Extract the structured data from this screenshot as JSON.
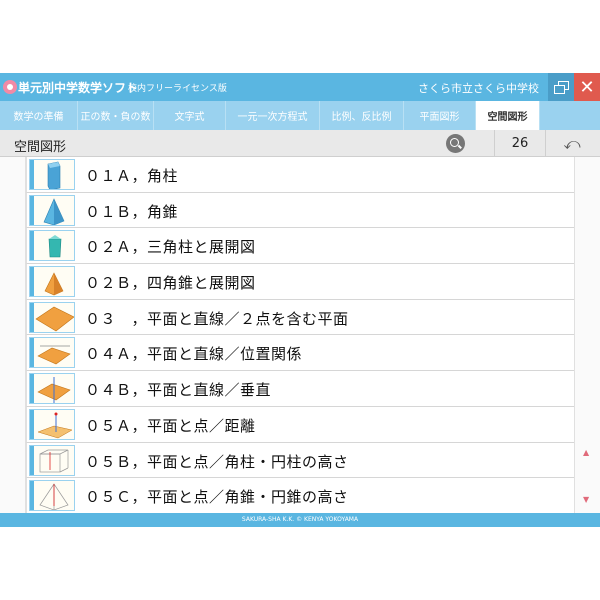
{
  "titlebar": {
    "app_title": "単元別中学数学ソフト",
    "license": "校内フリーライセンス版",
    "school": "さくら市立さくら中学校",
    "close_glyph": "✕"
  },
  "tabs": [
    {
      "label": "数学の準備"
    },
    {
      "label": "正の数・負の数"
    },
    {
      "label": "文字式"
    },
    {
      "label": "一元一次方程式"
    },
    {
      "label": "比例、反比例"
    },
    {
      "label": "平面図形"
    },
    {
      "label": "空間図形",
      "active": true
    }
  ],
  "subbar": {
    "section_title": "空間図形",
    "count": "26",
    "back_glyph": "⤺"
  },
  "items": [
    {
      "label": "０１Ａ，角柱",
      "icon": "prism-thumbnail-icon"
    },
    {
      "label": "０１Ｂ，角錐",
      "icon": "pyramid-thumbnail-icon"
    },
    {
      "label": "０２Ａ，三角柱と展開図",
      "icon": "triangular-prism-thumbnail-icon"
    },
    {
      "label": "０２Ｂ，四角錐と展開図",
      "icon": "square-pyramid-thumbnail-icon"
    },
    {
      "label": "０３　，平面と直線／２点を含む平面",
      "icon": "plane-thumbnail-icon"
    },
    {
      "label": "０４Ａ，平面と直線／位置関係",
      "icon": "plane-line-thumbnail-icon"
    },
    {
      "label": "０４Ｂ，平面と直線／垂直",
      "icon": "plane-perpendicular-thumbnail-icon"
    },
    {
      "label": "０５Ａ，平面と点／距離",
      "icon": "plane-point-thumbnail-icon"
    },
    {
      "label": "０５Ｂ，平面と点／角柱・円柱の高さ",
      "icon": "prism-height-thumbnail-icon"
    },
    {
      "label": "０５Ｃ，平面と点／角錐・円錐の高さ",
      "icon": "pyramid-height-thumbnail-icon"
    }
  ],
  "scroll": {
    "up_glyph": "▲",
    "down_glyph": "▼"
  },
  "footer": {
    "copyright": "SAKURA-SHA K.K.   © KENYA YOKOYAMA"
  }
}
